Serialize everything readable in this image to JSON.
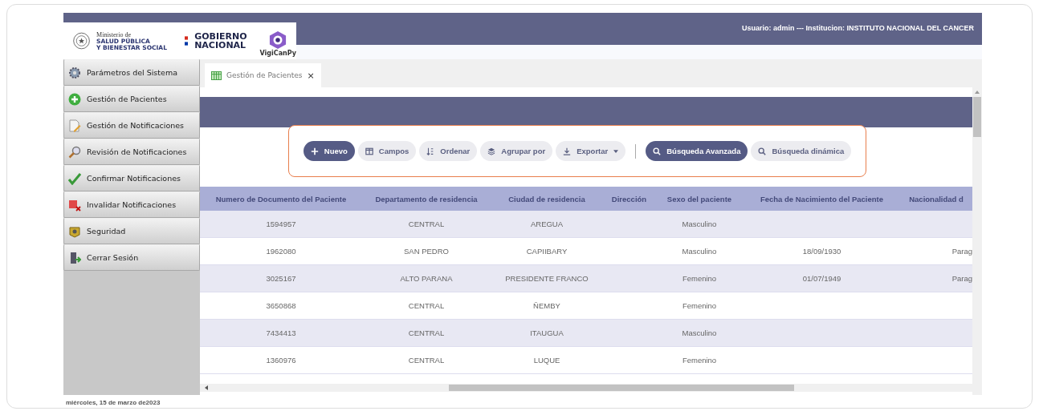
{
  "header": {
    "ministry_small": "Ministerio de",
    "ministry": "SALUD PÚBLICA\nY BIENESTAR SOCIAL",
    "government": "GOBIERNO\nNACIONAL",
    "app_name": "VigiCanPy",
    "user_info": "Usuario: admin --- Institucion: INSTITUTO NACIONAL DEL CANCER"
  },
  "sidebar": {
    "items": [
      {
        "label": "Parámetros del Sistema"
      },
      {
        "label": "Gestión de Pacientes"
      },
      {
        "label": "Gestión de Notificaciones"
      },
      {
        "label": "Revisión de Notificaciones"
      },
      {
        "label": "Confirmar Notificaciones"
      },
      {
        "label": "Invalidar Notificaciones"
      },
      {
        "label": "Seguridad"
      },
      {
        "label": "Cerrar Sesión"
      }
    ]
  },
  "tabs": [
    {
      "label": "Gestión de Pacientes",
      "close": "×",
      "selected": true
    }
  ],
  "toolbar": {
    "actions": [
      {
        "label": "Nuevo",
        "kind": "primary"
      },
      {
        "label": "Campos",
        "kind": "secondary"
      },
      {
        "label": "Ordenar",
        "kind": "secondary"
      },
      {
        "label": "Agrupar por",
        "kind": "secondary"
      },
      {
        "label": "Exportar",
        "kind": "secondary",
        "dropdown": true
      }
    ],
    "search_buttons": [
      {
        "label": "Búsqueda Avanzada",
        "kind": "primary"
      },
      {
        "label": "Búsqueda dinámica",
        "kind": "secondary"
      }
    ]
  },
  "table": {
    "columns": [
      "Numero de Documento del Paciente",
      "Departamento de residencia",
      "Ciudad de residencia",
      "Dirección",
      "Sexo del paciente",
      "Fecha de Nacimiento del Paciente",
      "Nacionalidad d"
    ],
    "rows": [
      [
        "1594957",
        "CENTRAL",
        "AREGUA",
        null,
        "Masculino",
        null,
        null
      ],
      [
        "1962080",
        "SAN PEDRO",
        "CAPIIBARY",
        null,
        "Masculino",
        "18/09/1930",
        "Parag"
      ],
      [
        "3025167",
        "ALTO PARANA",
        "PRESIDENTE FRANCO",
        null,
        "Femenino",
        "01/07/1949",
        "Parag"
      ],
      [
        "3650868",
        "CENTRAL",
        "ÑEMBY",
        null,
        "Femenino",
        null,
        null
      ],
      [
        "7434413",
        "CENTRAL",
        "ITAUGUA",
        null,
        "Masculino",
        null,
        null
      ],
      [
        "1360976",
        "CENTRAL",
        "LUQUE",
        null,
        "Femenino",
        null,
        null
      ]
    ]
  },
  "status_bar": {
    "date": "miércoles, 15 de marzo de2023"
  }
}
